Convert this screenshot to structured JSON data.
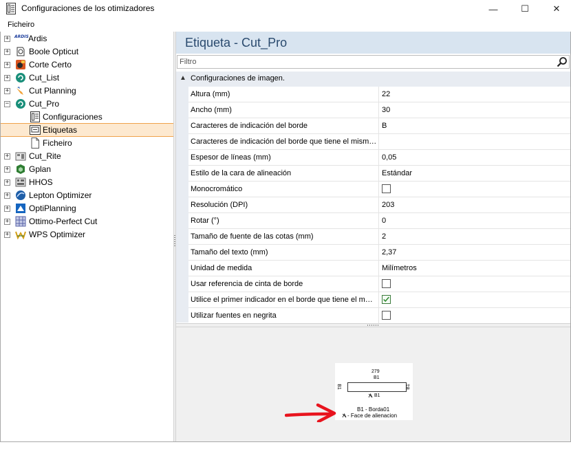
{
  "window": {
    "title": "Configuraciones de los otimizadores",
    "minimize": "—",
    "maximize": "☐",
    "close": "✕"
  },
  "menu": {
    "file": "Ficheiro"
  },
  "tree": {
    "items": [
      {
        "label": "Ardis",
        "expander": "+",
        "icon": "ardis-logo-icon",
        "icon_text": "ARDIS"
      },
      {
        "label": "Boole Opticut",
        "expander": "+",
        "icon": "boole-opticut-icon"
      },
      {
        "label": "Corte Certo",
        "expander": "+",
        "icon": "corte-certo-icon"
      },
      {
        "label": "Cut_List",
        "expander": "+",
        "icon": "cut-list-icon"
      },
      {
        "label": "Cut Planning",
        "expander": "+",
        "icon": "cut-planning-icon"
      },
      {
        "label": "Cut_Pro",
        "expander": "−",
        "icon": "cut-pro-icon"
      },
      {
        "label": "Configuraciones",
        "icon": "settings-doc-icon"
      },
      {
        "label": "Etiquetas",
        "icon": "label-icon"
      },
      {
        "label": "Ficheiro",
        "icon": "file-icon"
      },
      {
        "label": "Cut_Rite",
        "expander": "+",
        "icon": "cut-rite-icon"
      },
      {
        "label": "Gplan",
        "expander": "+",
        "icon": "gplan-icon"
      },
      {
        "label": "HHOS",
        "expander": "+",
        "icon": "hhos-icon"
      },
      {
        "label": "Lepton Optimizer",
        "expander": "+",
        "icon": "lepton-optimizer-icon"
      },
      {
        "label": "OptiPlanning",
        "expander": "+",
        "icon": "optiplanning-icon"
      },
      {
        "label": "Ottimo-Perfect Cut",
        "expander": "+",
        "icon": "ottimo-perfect-cut-icon"
      },
      {
        "label": "WPS Optimizer",
        "expander": "+",
        "icon": "wps-optimizer-icon"
      }
    ],
    "selected": "Etiquetas"
  },
  "panel": {
    "title": "Etiqueta - Cut_Pro",
    "filter_placeholder": "Filtro",
    "category": "Configuraciones de imagen.",
    "category_arrow": "▲",
    "properties": [
      {
        "name": "Altura (mm)",
        "value": "22"
      },
      {
        "name": "Ancho (mm)",
        "value": "30"
      },
      {
        "name": "Caracteres de indicación del borde",
        "value": "B"
      },
      {
        "name": "Caracteres de indicación del borde que tiene el mism…",
        "value": ""
      },
      {
        "name": "Espesor de líneas (mm)",
        "value": "0,05"
      },
      {
        "name": "Estilo de la cara de alineación",
        "value": "Estándar"
      },
      {
        "name": "Monocromático",
        "checkbox": false
      },
      {
        "name": "Resolución (DPI)",
        "value": "203"
      },
      {
        "name": "Rotar (°)",
        "value": "0"
      },
      {
        "name": "Tamaño de fuente de las cotas (mm)",
        "value": "2"
      },
      {
        "name": "Tamaño del texto (mm)",
        "value": "2,37"
      },
      {
        "name": "Unidad de medida",
        "value": "Milímetros"
      },
      {
        "name": "Usar referencia de cinta de borde",
        "checkbox": false
      },
      {
        "name": "Utilice el primer indicador en el borde que tiene el m…",
        "checkbox": true
      },
      {
        "name": "Utilizar fuentes en negrita",
        "checkbox": false
      }
    ]
  },
  "preview": {
    "dimension_top": "279",
    "edge_top": "B1",
    "edge_left": "B1",
    "edge_right": "B1",
    "edge_bottom": "B1",
    "legend_line1": "B1 - Borda01",
    "legend_line2": "- Face de alienacion",
    "arrow_color": "#e8141e"
  },
  "colors": {
    "header_bg": "#d8e4f0",
    "header_text": "#2a4a6e",
    "selection_bg": "#fde9d0",
    "selection_border": "#f0a14a"
  }
}
